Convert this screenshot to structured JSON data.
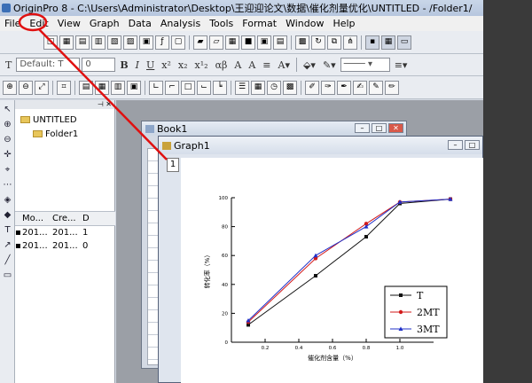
{
  "titlebar": {
    "title": "OriginPro 8 - C:\\Users\\Administrator\\Desktop\\王迎迎论文\\数据\\催化剂量优化\\UNTITLED - /Folder1/"
  },
  "menubar": {
    "items": [
      "File",
      "Edit",
      "View",
      "Graph",
      "Data",
      "Analysis",
      "Tools",
      "Format",
      "Window",
      "Help"
    ]
  },
  "format_toolbar": {
    "font": "Default: T",
    "size": "0"
  },
  "explorer": {
    "tree": {
      "root": "UNTITLED",
      "child": "Folder1"
    },
    "columns": [
      "Mo...",
      "Cre...",
      "D"
    ],
    "rows": [
      [
        "201...",
        "201...",
        "1"
      ],
      [
        "201...",
        "201...",
        "0"
      ]
    ]
  },
  "book1": {
    "title": "Book1"
  },
  "graph1": {
    "title": "Graph1",
    "layer": "1"
  },
  "annotation_color": "#e01010",
  "chart_data": {
    "type": "line",
    "xlabel": "催化剂含量（%）",
    "ylabel": "转化率（%）",
    "xlim": [
      0,
      1.2
    ],
    "ylim": [
      0,
      100
    ],
    "xticks": [
      {
        "v": 0.2,
        "label": "0.2"
      },
      {
        "v": 0.4,
        "label": "0.4"
      },
      {
        "v": 0.6,
        "label": "0.6"
      },
      {
        "v": 0.8,
        "label": "0.8"
      },
      {
        "v": 1.0,
        "label": "1.0"
      }
    ],
    "yticks": [
      "0",
      "20",
      "40",
      "60",
      "80",
      "100"
    ],
    "x": [
      0.1,
      0.5,
      0.8,
      1.0,
      1.3
    ],
    "series": [
      {
        "name": "T",
        "values": [
          12,
          46,
          73,
          96,
          99
        ],
        "color": "#111111",
        "marker": "square"
      },
      {
        "name": "2MT",
        "values": [
          14,
          58,
          82,
          97,
          99
        ],
        "color": "#d21a1a",
        "marker": "circle"
      },
      {
        "name": "3MT",
        "values": [
          15,
          60,
          80,
          97,
          99
        ],
        "color": "#2030c8",
        "marker": "triangle"
      }
    ],
    "legend_position": "bottom-right"
  }
}
